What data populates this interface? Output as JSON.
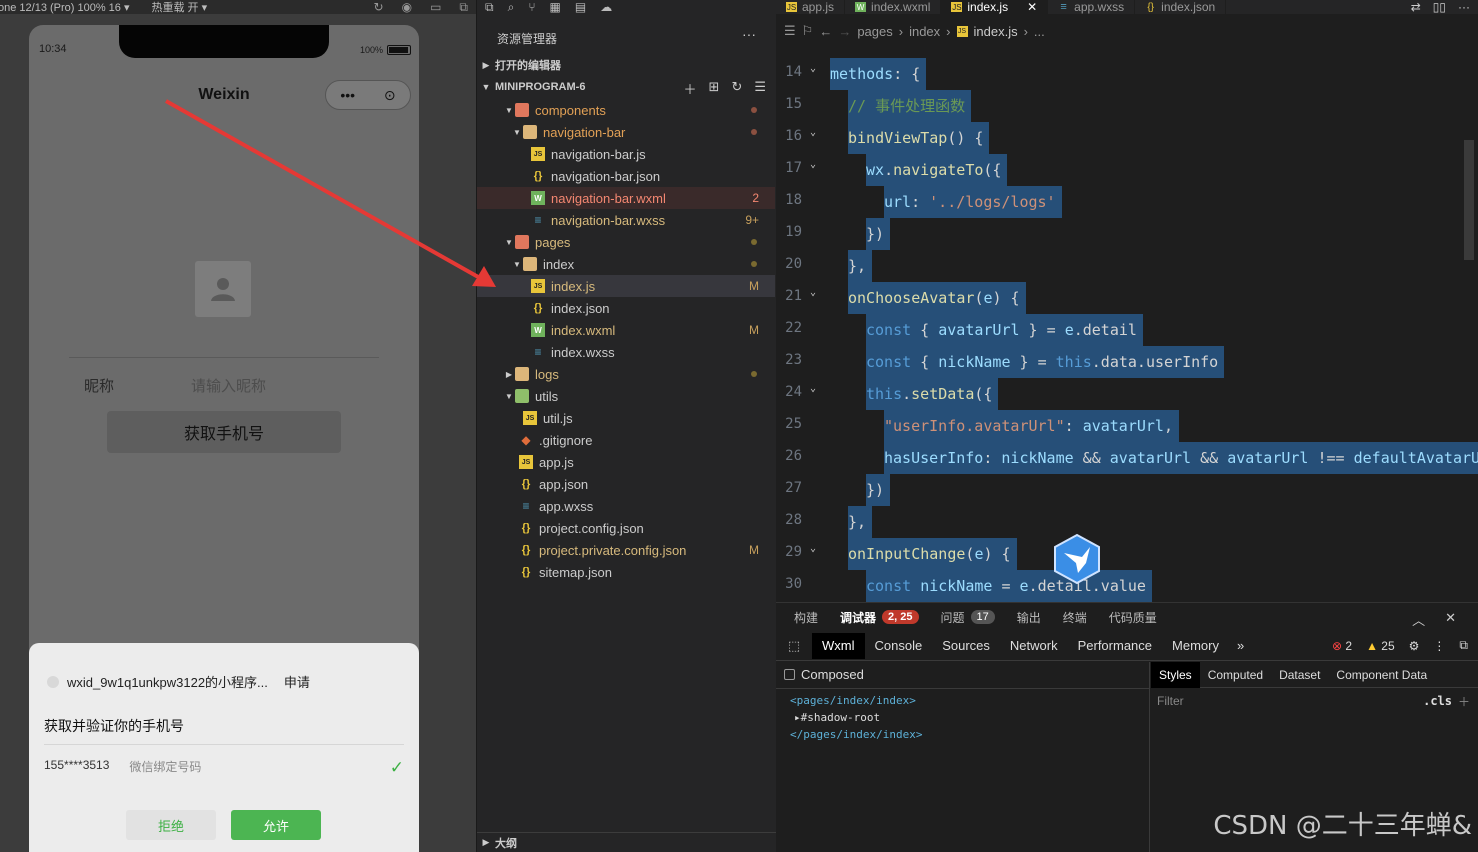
{
  "simulator": {
    "device_label": "one 12/13 (Pro) 100% 16 ▾",
    "hot_reload": "热重载 开 ▾",
    "status_time": "10:34",
    "battery": "100%",
    "page_title": "Weixin",
    "capsule_more": "•••",
    "capsule_close": "⊙",
    "nickname_label": "昵称",
    "nickname_placeholder": "请输入昵称",
    "get_phone_button": "获取手机号",
    "auth_sheet": {
      "app_name": "wxid_9w1q1unkpw3122的小程序...",
      "request": "申请",
      "description": "获取并验证你的手机号",
      "phone": "155****3513",
      "phone_note": "微信绑定号码",
      "deny": "拒绝",
      "allow": "允许"
    }
  },
  "explorer": {
    "title": "资源管理器",
    "more": "···",
    "open_editors": "打开的编辑器",
    "project": "MINIPROGRAM-6",
    "outline": "大纲",
    "tree": [
      {
        "name": "components",
        "type": "folder-red",
        "depth": 1,
        "expanded": true,
        "color": "orange",
        "dot": "#8b5040"
      },
      {
        "name": "navigation-bar",
        "type": "folder",
        "depth": 2,
        "expanded": true,
        "color": "orange",
        "dot": "#8b5040"
      },
      {
        "name": "navigation-bar.js",
        "type": "js",
        "depth": 3
      },
      {
        "name": "navigation-bar.json",
        "type": "json",
        "depth": 3
      },
      {
        "name": "navigation-bar.wxml",
        "type": "wxml",
        "depth": 3,
        "color": "red",
        "badge": "2"
      },
      {
        "name": "navigation-bar.wxss",
        "type": "wxss",
        "depth": 3,
        "color": "yellow",
        "badge": "9+"
      },
      {
        "name": "pages",
        "type": "folder-red",
        "depth": 1,
        "expanded": true,
        "color": "yellow",
        "dot": "#7a6a30"
      },
      {
        "name": "index",
        "type": "folder",
        "depth": 2,
        "expanded": true,
        "dot": "#7a6a30"
      },
      {
        "name": "index.js",
        "type": "js",
        "depth": 3,
        "color": "yellow",
        "badge": "M",
        "selected": true
      },
      {
        "name": "index.json",
        "type": "json",
        "depth": 3
      },
      {
        "name": "index.wxml",
        "type": "wxml",
        "depth": 3,
        "color": "yellow",
        "badge": "M"
      },
      {
        "name": "index.wxss",
        "type": "wxss",
        "depth": 3
      },
      {
        "name": "logs",
        "type": "folder",
        "depth": 1,
        "expanded": false,
        "color": "yellow",
        "dot": "#7a6a30"
      },
      {
        "name": "utils",
        "type": "folder-green",
        "depth": 1,
        "expanded": true
      },
      {
        "name": "util.js",
        "type": "js",
        "depth": 2
      },
      {
        "name": ".gitignore",
        "type": "git",
        "depth": 0
      },
      {
        "name": "app.js",
        "type": "js",
        "depth": 0
      },
      {
        "name": "app.json",
        "type": "json",
        "depth": 0
      },
      {
        "name": "app.wxss",
        "type": "wxss",
        "depth": 0
      },
      {
        "name": "project.config.json",
        "type": "json",
        "depth": 0
      },
      {
        "name": "project.private.config.json",
        "type": "json",
        "depth": 0,
        "color": "yellow",
        "badge": "M"
      },
      {
        "name": "sitemap.json",
        "type": "json",
        "depth": 0
      }
    ]
  },
  "editor": {
    "tabs": [
      {
        "label": "app.js",
        "icon": "JS"
      },
      {
        "label": "index.wxml",
        "icon": "W"
      },
      {
        "label": "index.js",
        "icon": "JS",
        "active": true
      },
      {
        "label": "app.wxss",
        "icon": "≡"
      },
      {
        "label": "index.json",
        "icon": "{}"
      }
    ],
    "breadcrumb": [
      "pages",
      "index",
      "index.js",
      "..."
    ],
    "lines": [
      {
        "n": "14",
        "fold": true,
        "indent": 0,
        "tokens": [
          [
            "methods",
            "prop"
          ],
          [
            ": {",
            "pu"
          ]
        ]
      },
      {
        "n": "15",
        "fold": false,
        "indent": 1,
        "tokens": [
          [
            "// 事件处理函数",
            "cm"
          ]
        ]
      },
      {
        "n": "16",
        "fold": true,
        "indent": 1,
        "tokens": [
          [
            "bindViewTap",
            "fn"
          ],
          [
            "() {",
            "pu"
          ]
        ]
      },
      {
        "n": "17",
        "fold": true,
        "indent": 2,
        "tokens": [
          [
            "wx",
            "prop"
          ],
          [
            ".",
            "pu"
          ],
          [
            "navigateTo",
            "fn"
          ],
          [
            "({",
            "pu"
          ]
        ]
      },
      {
        "n": "18",
        "fold": false,
        "indent": 3,
        "tokens": [
          [
            "url",
            "prop"
          ],
          [
            ": ",
            "pu"
          ],
          [
            "'../logs/logs'",
            "str"
          ]
        ]
      },
      {
        "n": "19",
        "fold": false,
        "indent": 2,
        "tokens": [
          [
            "})",
            "pu"
          ]
        ]
      },
      {
        "n": "20",
        "fold": false,
        "indent": 1,
        "tokens": [
          [
            "},",
            "pu"
          ]
        ]
      },
      {
        "n": "21",
        "fold": true,
        "indent": 1,
        "tokens": [
          [
            "onChooseAvatar",
            "fn"
          ],
          [
            "(",
            "pu"
          ],
          [
            "e",
            "prop"
          ],
          [
            ") {",
            "pu"
          ]
        ]
      },
      {
        "n": "22",
        "fold": false,
        "indent": 2,
        "tokens": [
          [
            "const",
            "kw"
          ],
          [
            " { ",
            "pu"
          ],
          [
            "avatarUrl",
            "prop"
          ],
          [
            " } = ",
            "pu"
          ],
          [
            "e",
            "prop"
          ],
          [
            ".detail",
            "pu"
          ]
        ]
      },
      {
        "n": "23",
        "fold": false,
        "indent": 2,
        "tokens": [
          [
            "const",
            "kw"
          ],
          [
            " { ",
            "pu"
          ],
          [
            "nickName",
            "prop"
          ],
          [
            " } = ",
            "pu"
          ],
          [
            "this",
            "kw"
          ],
          [
            ".data.userInfo",
            "pu"
          ]
        ]
      },
      {
        "n": "24",
        "fold": true,
        "indent": 2,
        "tokens": [
          [
            "this",
            "kw"
          ],
          [
            ".",
            "pu"
          ],
          [
            "setData",
            "fn"
          ],
          [
            "({",
            "pu"
          ]
        ]
      },
      {
        "n": "25",
        "fold": false,
        "indent": 3,
        "tokens": [
          [
            "\"userInfo.avatarUrl\"",
            "str"
          ],
          [
            ": ",
            "pu"
          ],
          [
            "avatarUrl",
            "prop"
          ],
          [
            ",",
            "pu"
          ]
        ]
      },
      {
        "n": "26",
        "fold": false,
        "indent": 3,
        "tokens": [
          [
            "hasUserInfo",
            "prop"
          ],
          [
            ": ",
            "pu"
          ],
          [
            "nickName",
            "prop"
          ],
          [
            " && ",
            "pu"
          ],
          [
            "avatarUrl",
            "prop"
          ],
          [
            " && ",
            "pu"
          ],
          [
            "avatarUrl",
            "prop"
          ],
          [
            " !== ",
            "pu"
          ],
          [
            "defaultAvatarUrl",
            "prop"
          ]
        ]
      },
      {
        "n": "27",
        "fold": false,
        "indent": 2,
        "tokens": [
          [
            "})",
            "pu"
          ]
        ]
      },
      {
        "n": "28",
        "fold": false,
        "indent": 1,
        "tokens": [
          [
            "},",
            "pu"
          ]
        ]
      },
      {
        "n": "29",
        "fold": true,
        "indent": 1,
        "tokens": [
          [
            "onInputChange",
            "fn"
          ],
          [
            "(",
            "pu"
          ],
          [
            "e",
            "prop"
          ],
          [
            ") {",
            "pu"
          ]
        ]
      },
      {
        "n": "30",
        "fold": false,
        "indent": 2,
        "tokens": [
          [
            "const",
            "kw"
          ],
          [
            " ",
            "pu"
          ],
          [
            "nickName",
            "prop"
          ],
          [
            " = ",
            "pu"
          ],
          [
            "e",
            "prop"
          ],
          [
            ".detail.value",
            "pu"
          ]
        ]
      }
    ]
  },
  "debug": {
    "tabs": [
      {
        "label": "构建"
      },
      {
        "label": "调试器",
        "active": true,
        "pill": "2, 25"
      },
      {
        "label": "问题",
        "pill": "17"
      },
      {
        "label": "输出"
      },
      {
        "label": "终端"
      },
      {
        "label": "代码质量"
      }
    ],
    "devtools_tabs": [
      "Wxml",
      "Console",
      "Sources",
      "Network",
      "Performance",
      "Memory"
    ],
    "more_tabs": "»",
    "errors": "2",
    "warnings": "25",
    "composed": "Composed",
    "wxml_tree": [
      "<pages/index/index>",
      "#shadow-root",
      "</pages/index/index>"
    ],
    "style_tabs": [
      "Styles",
      "Computed",
      "Dataset",
      "Component Data"
    ],
    "filter_placeholder": "Filter",
    "cls": ".cls"
  },
  "watermark": "CSDN @二十三年蝉&",
  "colors": {
    "accent_red": "#e53935",
    "allow_green": "#4cb552",
    "selection": "#264f78"
  }
}
